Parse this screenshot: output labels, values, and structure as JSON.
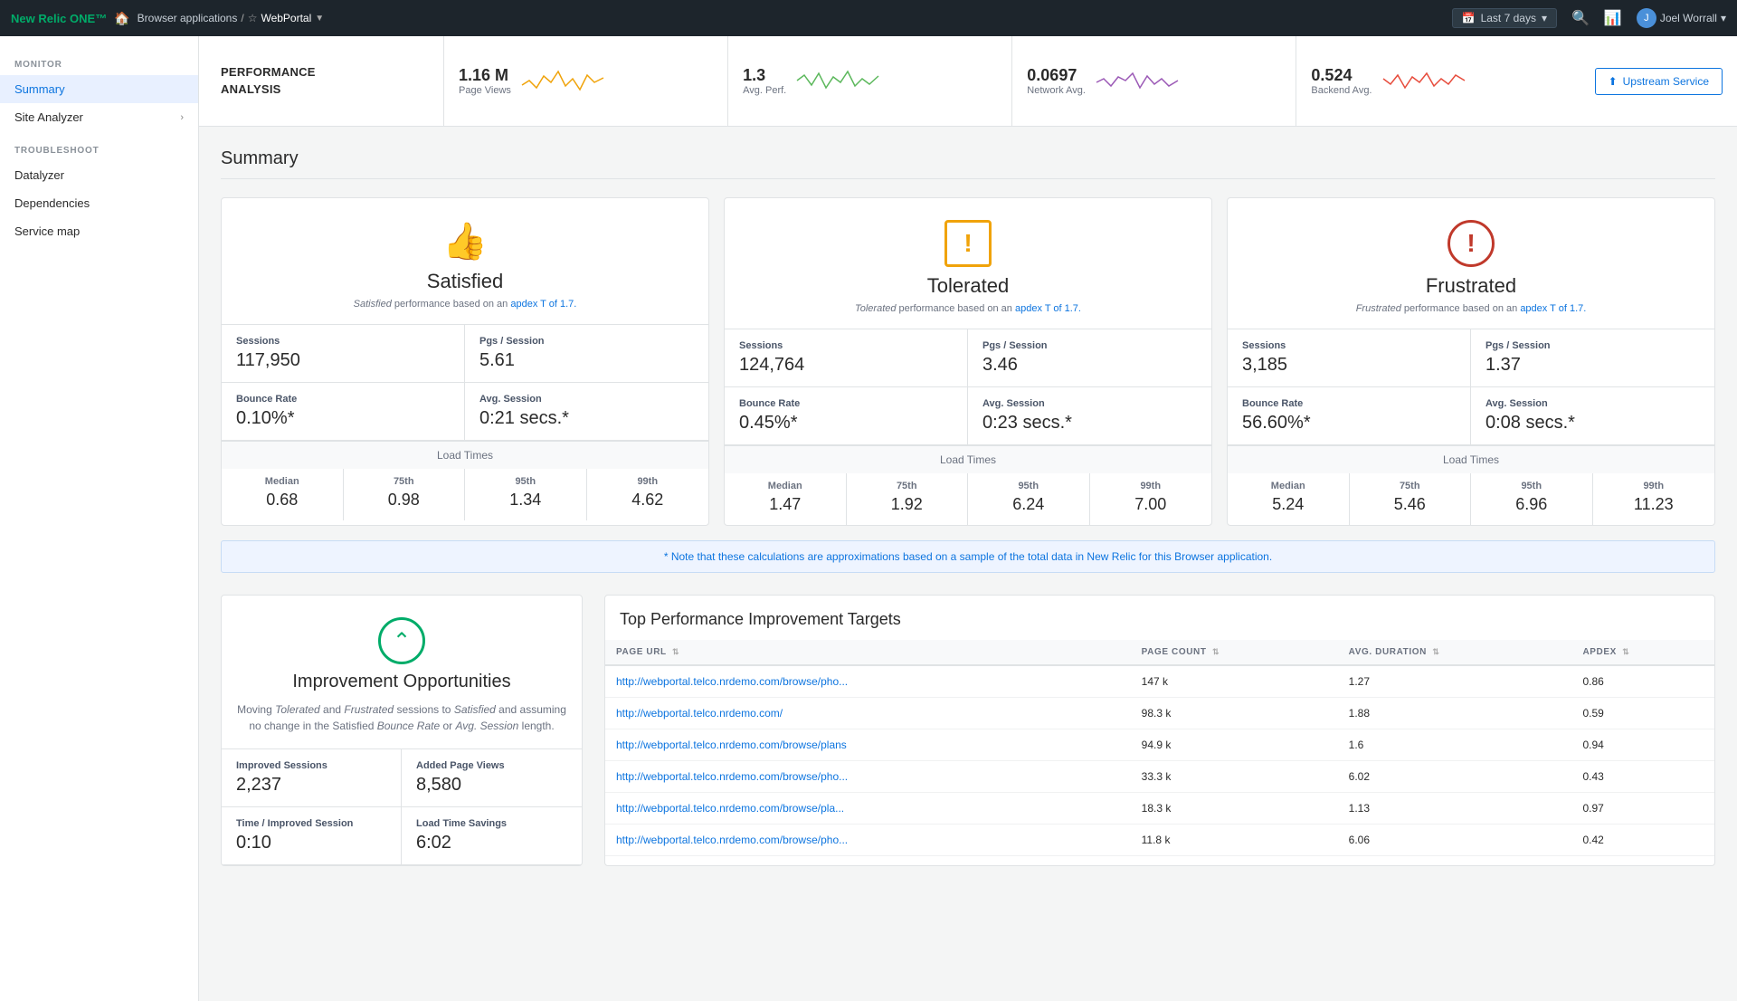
{
  "topnav": {
    "logo": "New Relic ONE™",
    "breadcrumb": {
      "home": "🏠",
      "app": "Browser applications",
      "sep1": "/",
      "star": "☆",
      "current": "WebPortal",
      "dropdown": "▼"
    },
    "time_range": "Last 7 days",
    "time_icon": "📅",
    "user": "Joel Worrall",
    "user_icon": "▼"
  },
  "sidebar": {
    "monitor_label": "MONITOR",
    "items": [
      {
        "label": "Summary",
        "active": true
      },
      {
        "label": "Site Analyzer",
        "hasChevron": true
      },
      {
        "label": "TROUBLESHOOT"
      },
      {
        "label": "Datalyzer"
      },
      {
        "label": "Dependencies"
      },
      {
        "label": "Service map"
      }
    ]
  },
  "perf_bar": {
    "title_line1": "PERFORMANCE",
    "title_line2": "ANALYSIS",
    "metrics": [
      {
        "value": "1.16 M",
        "label": "Page Views",
        "color": "#f0a30a"
      },
      {
        "value": "1.3",
        "label": "Avg. Perf.",
        "color": "#5cb85c"
      },
      {
        "value": "0.0697",
        "label": "Network Avg.",
        "color": "#9b59b6"
      },
      {
        "value": "0.524",
        "label": "Backend Avg.",
        "color": "#e74c3c"
      }
    ],
    "upstream_btn": "Upstream Service"
  },
  "summary_title": "Summary",
  "apdex": {
    "satisfied": {
      "title": "Satisfied",
      "icon": "👍",
      "desc_prefix": "Satisfied",
      "desc_mid": " performance based on an ",
      "desc_link": "apdex T of 1.7.",
      "sessions": "117,950",
      "pgs_session": "5.61",
      "bounce_rate": "0.10%*",
      "avg_session": "0:21 secs.*",
      "load_times_label": "Load Times",
      "median": "0.68",
      "p75": "0.98",
      "p95": "1.34",
      "p99": "4.62"
    },
    "tolerated": {
      "title": "Tolerated",
      "icon": "⚠",
      "desc_prefix": "Tolerated",
      "desc_mid": " performance based on an ",
      "desc_link": "apdex T of 1.7.",
      "sessions": "124,764",
      "pgs_session": "3.46",
      "bounce_rate": "0.45%*",
      "avg_session": "0:23 secs.*",
      "load_times_label": "Load Times",
      "median": "1.47",
      "p75": "1.92",
      "p95": "6.24",
      "p99": "7.00"
    },
    "frustrated": {
      "title": "Frustrated",
      "icon": "🚫",
      "desc_prefix": "Frustrated",
      "desc_mid": " performance based on an ",
      "desc_link": "apdex T of 1.7.",
      "sessions": "3,185",
      "pgs_session": "1.37",
      "bounce_rate": "56.60%*",
      "avg_session": "0:08 secs.*",
      "load_times_label": "Load Times",
      "median": "5.24",
      "p75": "5.46",
      "p95": "6.96",
      "p99": "11.23"
    }
  },
  "note": "* Note that these calculations are approximations based on a sample of the total data in New Relic for this Browser application.",
  "improvement": {
    "title": "Improvement Opportunities",
    "desc": "Moving Tolerated and Frustrated sessions to Satisfied and assuming no change in the Satisfied Bounce Rate or Avg. Session length.",
    "improved_sessions_label": "Improved Sessions",
    "improved_sessions": "2,237",
    "added_pv_label": "Added Page Views",
    "added_pv": "8,580",
    "time_label": "Time / Improved Session",
    "time_value": "0:10",
    "load_savings_label": "Load Time Savings",
    "load_savings": "6:02"
  },
  "top_perf": {
    "title": "Top Performance Improvement Targets",
    "columns": [
      "PAGE URL",
      "PAGE COUNT",
      "AVG. DURATION",
      "APDEX"
    ],
    "rows": [
      {
        "url": "http://webportal.telco.nrdemo.com/browse/pho...",
        "page_count": "147 k",
        "avg_duration": "1.27",
        "apdex": "0.86"
      },
      {
        "url": "http://webportal.telco.nrdemo.com/",
        "page_count": "98.3 k",
        "avg_duration": "1.88",
        "apdex": "0.59"
      },
      {
        "url": "http://webportal.telco.nrdemo.com/browse/plans",
        "page_count": "94.9 k",
        "avg_duration": "1.6",
        "apdex": "0.94"
      },
      {
        "url": "http://webportal.telco.nrdemo.com/browse/pho...",
        "page_count": "33.3 k",
        "avg_duration": "6.02",
        "apdex": "0.43"
      },
      {
        "url": "http://webportal.telco.nrdemo.com/browse/pla...",
        "page_count": "18.3 k",
        "avg_duration": "1.13",
        "apdex": "0.97"
      },
      {
        "url": "http://webportal.telco.nrdemo.com/browse/pho...",
        "page_count": "11.8 k",
        "avg_duration": "6.06",
        "apdex": "0.42"
      }
    ]
  }
}
